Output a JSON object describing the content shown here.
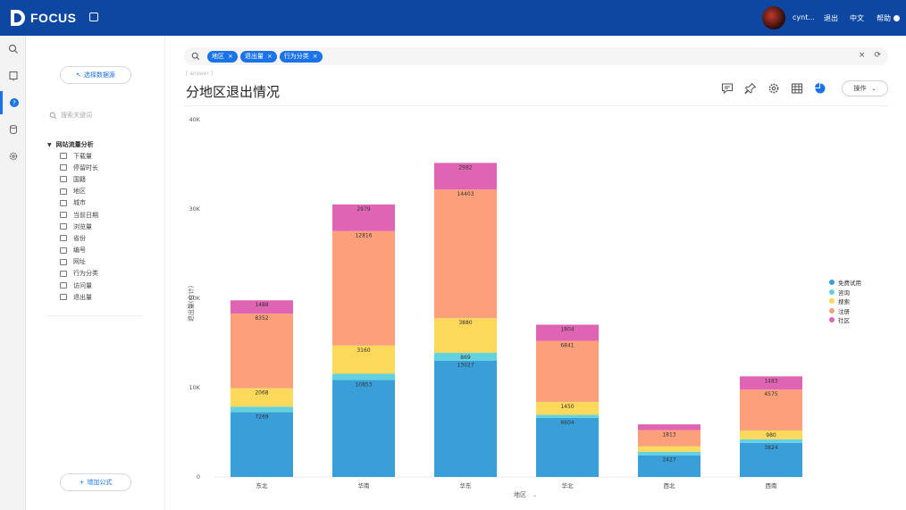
{
  "app": {
    "brand": "FOCUS"
  },
  "header": {
    "user": "cynt...",
    "logout": "退出",
    "language": "中文",
    "help": "帮助"
  },
  "panel": {
    "select_source": "选择数据源",
    "keyword_placeholder": "搜索关键词",
    "tree_title": "网站流量分析",
    "tree_items": [
      "下载量",
      "停留时长",
      "国籍",
      "地区",
      "城市",
      "当前日期",
      "浏览量",
      "省份",
      "编号",
      "网址",
      "行为分类",
      "访问量",
      "退出量"
    ],
    "add_formula": "增加公式"
  },
  "search": {
    "chips": [
      "地区",
      "退出量",
      "行为分类"
    ]
  },
  "breadcrumb": "[ answer ]",
  "title": "分地区退出情况",
  "toolbar": {
    "operate": "操作"
  },
  "colors": {
    "header_bg": "#0d47a1",
    "accent": "#1a73e8",
    "series": [
      "#3a9fd8",
      "#62d2e0",
      "#fcd85b",
      "#fca07c",
      "#df65b4"
    ]
  },
  "chart_data": {
    "type": "bar",
    "stacked": true,
    "categories": [
      "东北",
      "华南",
      "华东",
      "华北",
      "西北",
      "西南"
    ],
    "xlabel": "地区",
    "ylabel": "退出量(合计)",
    "ylim": [
      0,
      40000
    ],
    "yticks": [
      "0",
      "10K",
      "20K",
      "30K",
      "40K"
    ],
    "legend_position": "right",
    "series": [
      {
        "name": "免费试用",
        "values": [
          7269,
          10853,
          13027,
          6604,
          2427,
          3824
        ]
      },
      {
        "name": "咨询",
        "values": [
          600,
          700,
          869,
          350,
          400,
          400
        ]
      },
      {
        "name": "搜索",
        "values": [
          2068,
          3160,
          3880,
          1450,
          600,
          980
        ]
      },
      {
        "name": "注册",
        "values": [
          8352,
          12816,
          14403,
          6841,
          1813,
          4575
        ]
      },
      {
        "name": "社区",
        "values": [
          1488,
          2979,
          2982,
          1804,
          650,
          1483
        ]
      }
    ],
    "labels": [
      [
        "7269",
        "10853",
        "13027",
        "6604",
        "2427",
        "3824"
      ],
      [
        "",
        "",
        "869",
        "",
        "",
        ""
      ],
      [
        "2068",
        "3160",
        "3880",
        "1450",
        "",
        "980"
      ],
      [
        "8352",
        "12816",
        "14403",
        "6841",
        "1813",
        "4575"
      ],
      [
        "1488",
        "2979",
        "2982",
        "1804",
        "",
        "1483"
      ]
    ]
  }
}
